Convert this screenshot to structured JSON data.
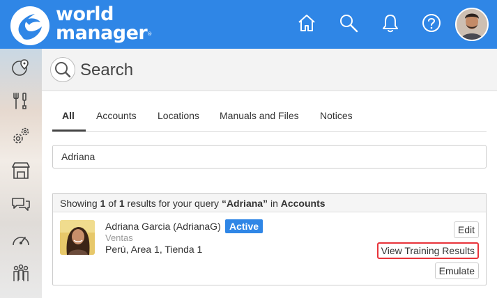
{
  "brand": {
    "line1": "world",
    "line2": "manager",
    "reg_mark": "®"
  },
  "colors": {
    "topbar": "#2f86e6",
    "badge": "#2f86e6",
    "highlight": "#e8333a"
  },
  "topnav": {
    "icons": [
      "home-icon",
      "search-icon",
      "bell-icon",
      "help-icon"
    ]
  },
  "sidebar": {
    "icons": [
      "map-pin-icon",
      "tools-icon",
      "gears-icon",
      "store-icon",
      "chat-bubbles-icon",
      "speedometer-icon",
      "people-icon"
    ]
  },
  "header": {
    "title": "Search"
  },
  "tabs": [
    {
      "label": "All",
      "active": true
    },
    {
      "label": "Accounts"
    },
    {
      "label": "Locations"
    },
    {
      "label": "Manuals and Files"
    },
    {
      "label": "Notices"
    }
  ],
  "search": {
    "value": "Adriana"
  },
  "results": {
    "prefix": "Showing ",
    "shown": "1",
    "of_text": " of ",
    "total": "1",
    "mid_text": " results for your query ",
    "query": "“Adriana”",
    "in_text": " in ",
    "scope": "Accounts",
    "user": {
      "name": "Adriana Garcia (AdrianaG)",
      "status": "Active",
      "department": "Ventas",
      "location": "Perú, Area 1, Tienda 1"
    },
    "actions": {
      "edit": "Edit",
      "training": "View Training Results",
      "emulate": "Emulate"
    }
  }
}
